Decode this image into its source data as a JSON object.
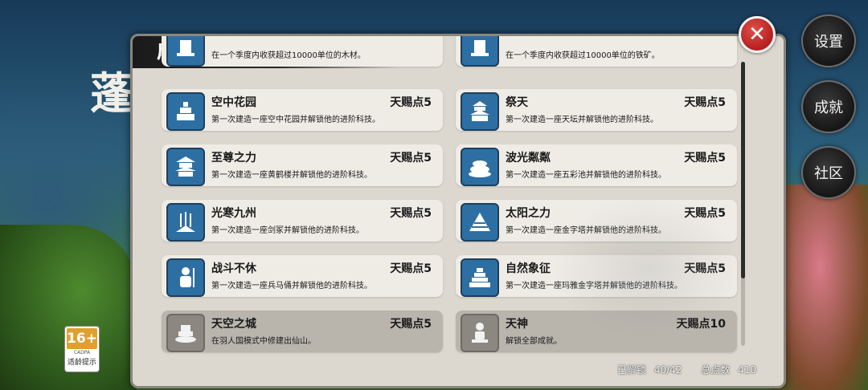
{
  "background": {
    "big_char": "蓬"
  },
  "side_menu": {
    "settings": "设置",
    "achievements": "成就",
    "community": "社区"
  },
  "age_rating": {
    "number": "16+",
    "org": "CADPA",
    "tip": "适龄提示"
  },
  "panel": {
    "title": "成就",
    "close_icon": "✕"
  },
  "achievements": [
    {
      "name": "",
      "reward": "",
      "desc": "在一个季度内收获超过10000单位的木材。",
      "icon": "tower-icon",
      "locked": false
    },
    {
      "name": "",
      "reward": "",
      "desc": "在一个季度内收获超过10000单位的铁矿。",
      "icon": "tower-icon",
      "locked": false
    },
    {
      "name": "空中花园",
      "reward": "天赐点5",
      "desc": "第一次建造一座空中花园并解锁他的进阶科技。",
      "icon": "hanging-garden-icon",
      "locked": false
    },
    {
      "name": "祭天",
      "reward": "天赐点5",
      "desc": "第一次建造一座天坛并解锁他的进阶科技。",
      "icon": "temple-of-heaven-icon",
      "locked": false
    },
    {
      "name": "至尊之力",
      "reward": "天赐点5",
      "desc": "第一次建造一座黄鹤楼并解锁他的进阶科技。",
      "icon": "pagoda-icon",
      "locked": false
    },
    {
      "name": "波光粼粼",
      "reward": "天赐点5",
      "desc": "第一次建造一座五彩池并解锁他的进阶科技。",
      "icon": "pool-icon",
      "locked": false
    },
    {
      "name": "光寒九州",
      "reward": "天赐点5",
      "desc": "第一次建造一座剑冢并解锁他的进阶科技。",
      "icon": "swords-icon",
      "locked": false
    },
    {
      "name": "太阳之力",
      "reward": "天赐点5",
      "desc": "第一次建造一座金字塔并解锁他的进阶科技。",
      "icon": "pyramid-icon",
      "locked": false
    },
    {
      "name": "战斗不休",
      "reward": "天赐点5",
      "desc": "第一次建造一座兵马俑并解锁他的进阶科技。",
      "icon": "warrior-icon",
      "locked": false
    },
    {
      "name": "自然象征",
      "reward": "天赐点5",
      "desc": "第一次建造一座玛雅金字塔并解锁他的进阶科技。",
      "icon": "mayan-pyramid-icon",
      "locked": false
    },
    {
      "name": "天空之城",
      "reward": "天赐点5",
      "desc": "在羽人国模式中修建出仙山。",
      "icon": "sky-city-icon",
      "locked": true
    },
    {
      "name": "天神",
      "reward": "天赐点10",
      "desc": "解锁全部成就。",
      "icon": "deity-icon",
      "locked": true
    }
  ],
  "footer": {
    "unlocked_label": "已解锁",
    "unlocked_value": "40/42",
    "points_label": "总点数",
    "points_value": "410"
  },
  "colors": {
    "icon_unlocked": "#2d6fa3",
    "icon_locked": "#8c8881",
    "panel_bg": "#dcd8cf",
    "close_red": "#c62828"
  }
}
